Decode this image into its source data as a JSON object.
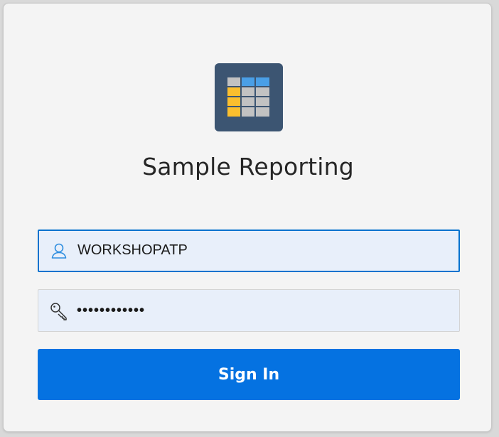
{
  "app": {
    "title": "Sample Reporting",
    "logo_icon": "table-grid-icon"
  },
  "login": {
    "username": {
      "value": "WORKSHOPATP",
      "icon": "user-icon"
    },
    "password": {
      "value": "••••••••••••",
      "icon": "key-icon"
    },
    "sign_in_label": "Sign In"
  },
  "colors": {
    "card_background": "#f4f4f4",
    "logo_background": "#3c5572",
    "input_background": "#e8effa",
    "focus_border": "#0572ce",
    "button_background": "#0572e1",
    "grid_yellow": "#fbbf2e",
    "grid_blue": "#4a9fe6",
    "grid_gray": "#c2c2c2"
  }
}
